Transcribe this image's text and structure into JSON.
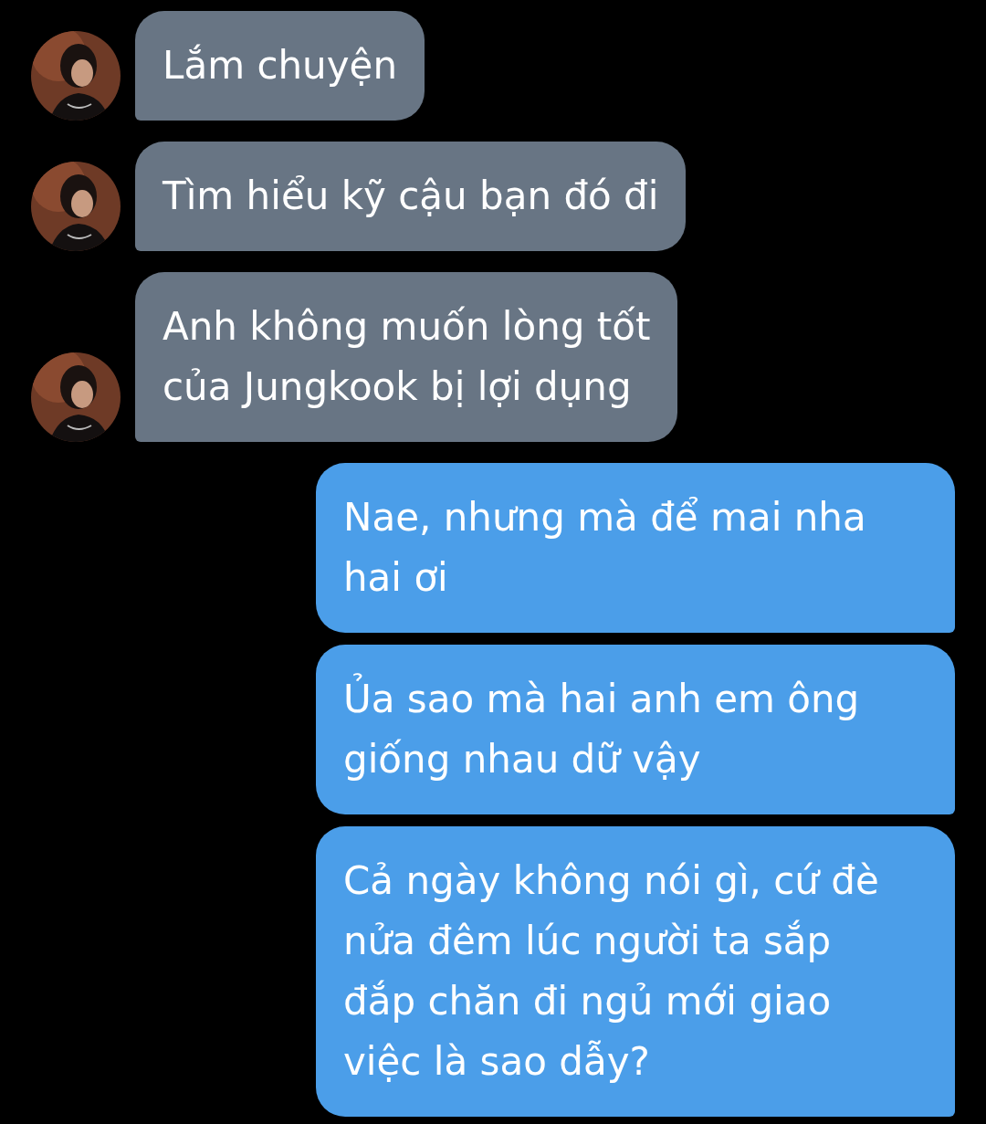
{
  "messages": [
    {
      "kind": "incoming",
      "text": "Lắm chuyện"
    },
    {
      "kind": "incoming",
      "text": "Tìm hiểu kỹ cậu bạn đó đi"
    },
    {
      "kind": "incoming",
      "text": "Anh không muốn lòng tốt\ncủa Jungkook bị lợi dụng"
    },
    {
      "kind": "outgoing",
      "text": "Nae, nhưng mà để mai nha\nhai ơi"
    },
    {
      "kind": "outgoing",
      "text": "Ủa sao mà hai anh em ông\ngiống nhau dữ vậy"
    },
    {
      "kind": "outgoing",
      "text": "Cả ngày không nói gì, cứ đè\nnửa đêm lúc người ta sắp\nđắp chăn đi ngủ mới giao\nviệc là sao dẫy?"
    }
  ]
}
